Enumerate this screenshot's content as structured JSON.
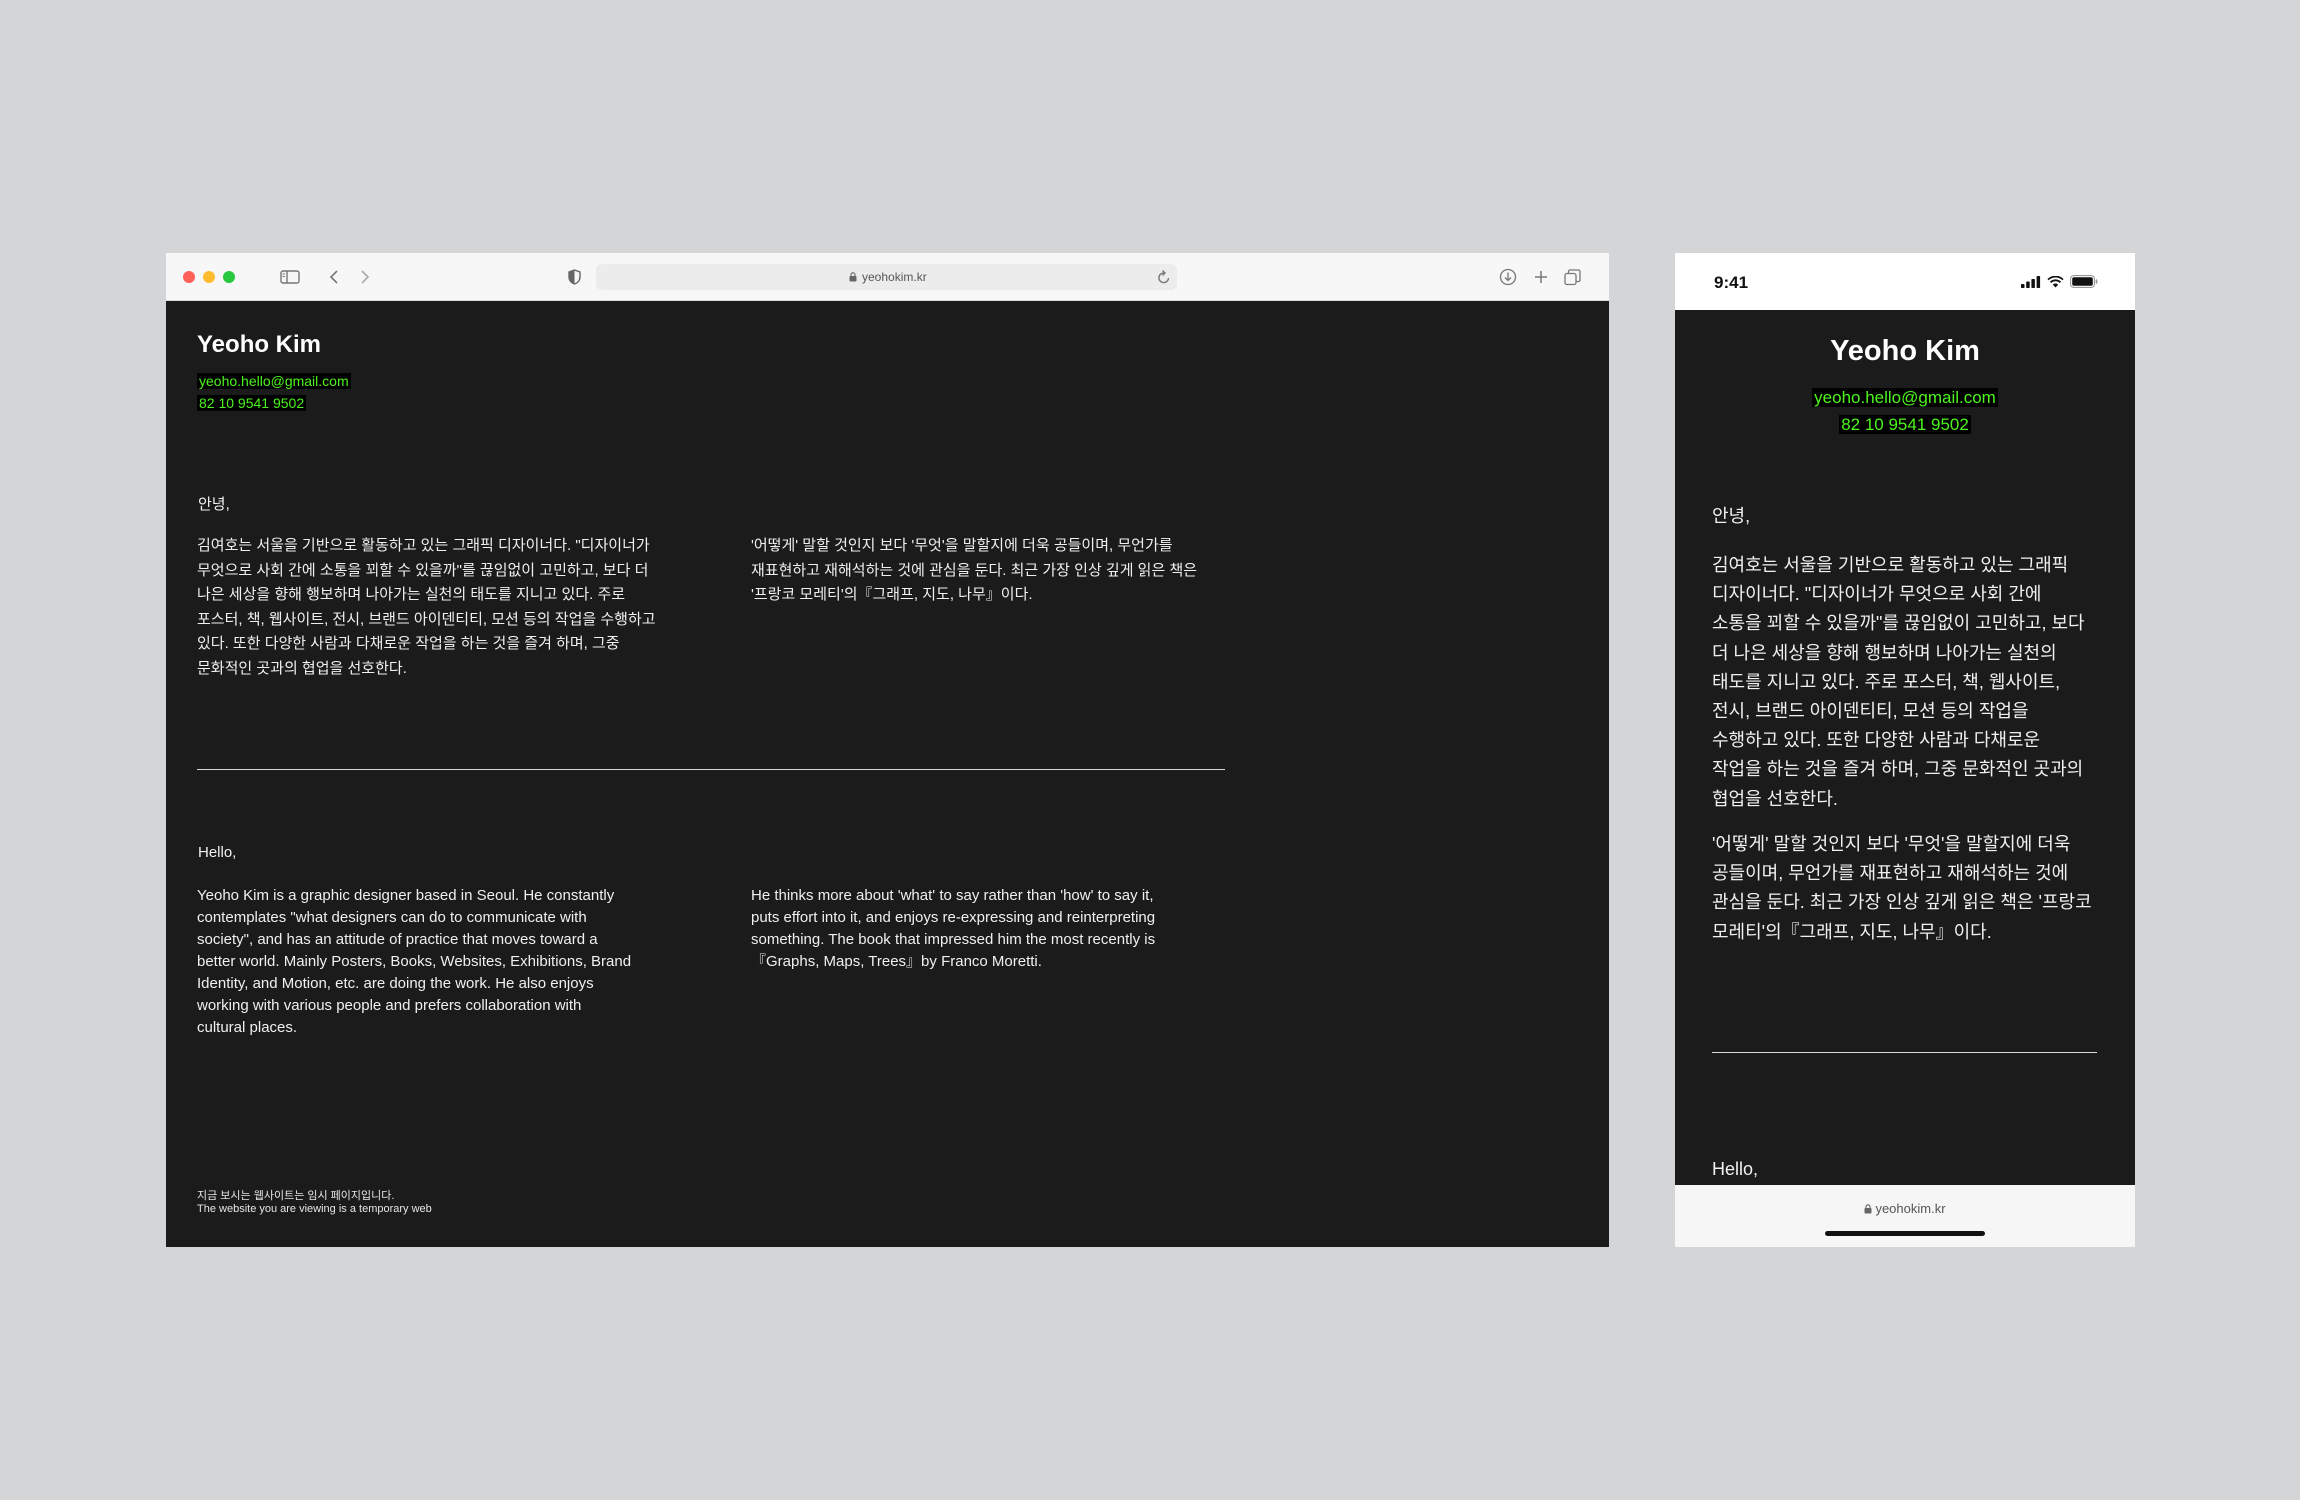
{
  "browser": {
    "url": "yeohokim.kr",
    "icons": [
      "sidebar-icon",
      "back-icon",
      "forward-icon",
      "shield-icon",
      "lock-icon",
      "reload-icon",
      "download-icon",
      "new-tab-icon",
      "tabs-overview-icon"
    ]
  },
  "site": {
    "title": "Yeoho Kim",
    "email": "yeoho.hello@gmail.com",
    "phone": "82 10 9541 9502",
    "ko": {
      "greeting": "안녕,",
      "para1_desktop": "김여호는 서울을 기반으로 활동하고 있는 그래픽 디자이너다. \"디자이너가\n무엇으로 사회 간에 소통을 꾀할 수 있을까\"를 끊임없이 고민하고, 보다 더\n나은 세상을 향해 행보하며 나아가는 실천의 태도를 지니고 있다. 주로\n포스터, 책, 웹사이트, 전시, 브랜드 아이덴티티, 모션 등의 작업을 수행하고\n있다. 또한 다양한 사람과 다채로운 작업을 하는 것을 즐겨 하며, 그중\n문화적인 곳과의 협업을 선호한다.",
      "para2_desktop": "'어떻게' 말할 것인지 보다 '무엇'을 말할지에 더욱 공들이며, 무언가를\n재표현하고 재해석하는 것에 관심을 둔다. 최근 가장 인상 깊게 읽은 책은\n'프랑코 모레티'의『그래프, 지도, 나무』이다.",
      "para1_mobile": "김여호는 서울을 기반으로 활동하고 있는 그래픽\n디자이너다. \"디자이너가 무엇으로 사회 간에\n소통을 꾀할 수 있을까\"를 끊임없이 고민하고, 보다\n더 나은 세상을 향해 행보하며 나아가는 실천의\n태도를 지니고 있다. 주로 포스터, 책, 웹사이트,\n전시, 브랜드 아이덴티티, 모션 등의 작업을\n수행하고 있다. 또한 다양한 사람과 다채로운\n작업을 하는 것을 즐겨 하며, 그중 문화적인 곳과의\n협업을 선호한다.",
      "para2_mobile": "'어떻게' 말할 것인지 보다 '무엇'을 말할지에 더욱\n공들이며, 무언가를 재표현하고 재해석하는 것에\n관심을 둔다. 최근 가장 인상 깊게 읽은 책은 '프랑코\n모레티'의『그래프, 지도, 나무』이다."
    },
    "en": {
      "greeting": "Hello,",
      "para1": "Yeoho Kim is a graphic designer based in Seoul. He constantly\ncontemplates \"what designers can do to communicate with\nsociety\", and has an attitude of practice that moves toward a\nbetter world. Mainly Posters, Books, Websites, Exhibitions, Brand\nIdentity, and Motion, etc. are doing the work. He also enjoys\nworking with various people and prefers collaboration with\ncultural places.",
      "para2": "He thinks more about 'what' to say rather than 'how' to say it,\nputs effort into it, and enjoys re-expressing and reinterpreting\nsomething. The book that impressed him the most recently is\n『Graphs, Maps, Trees』by Franco Moretti."
    },
    "footer": {
      "ko": "지금 보시는 웹사이트는 임시 페이지입니다.",
      "en": "The website you are viewing is a temporary web"
    }
  },
  "mobile": {
    "time": "9:41",
    "url": "yeohokim.kr"
  },
  "colors": {
    "background": "#d4d5d7",
    "page": "#1b1b1b",
    "accent_text": "#4cf51c",
    "accent_bg": "#000000"
  }
}
